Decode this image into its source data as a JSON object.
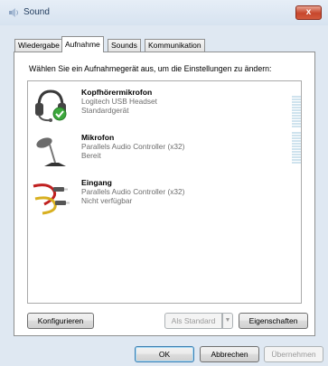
{
  "window": {
    "title": "Sound",
    "close_label": "x"
  },
  "tabs": [
    {
      "label": "Wiedergabe",
      "active": false
    },
    {
      "label": "Aufnahme",
      "active": true
    },
    {
      "label": "Sounds",
      "active": false
    },
    {
      "label": "Kommunikation",
      "active": false
    }
  ],
  "panel": {
    "instruction": "Wählen Sie ein Aufnahmegerät aus, um die Einstellungen zu ändern:",
    "devices": [
      {
        "name": "Kopfhörermikrofon",
        "description": "Logitech USB Headset",
        "status": "Standardgerät",
        "icon": "headset-icon",
        "default": true
      },
      {
        "name": "Mikrofon",
        "description": "Parallels Audio Controller (x32)",
        "status": "Bereit",
        "icon": "microphone-icon",
        "default": false
      },
      {
        "name": "Eingang",
        "description": "Parallels Audio Controller (x32)",
        "status": "Nicht verfügbar",
        "icon": "line-in-cable-icon",
        "default": false
      }
    ],
    "configure_label": "Konfigurieren",
    "set_default_label": "Als Standard",
    "properties_label": "Eigenschaften"
  },
  "footer": {
    "ok_label": "OK",
    "cancel_label": "Abbrechen",
    "apply_label": "Übernehmen"
  },
  "colors": {
    "window_bg": "#dfe8f2",
    "close_button": "#c7462c",
    "default_check": "#3ca83c",
    "meter": "#cfe3ee"
  }
}
